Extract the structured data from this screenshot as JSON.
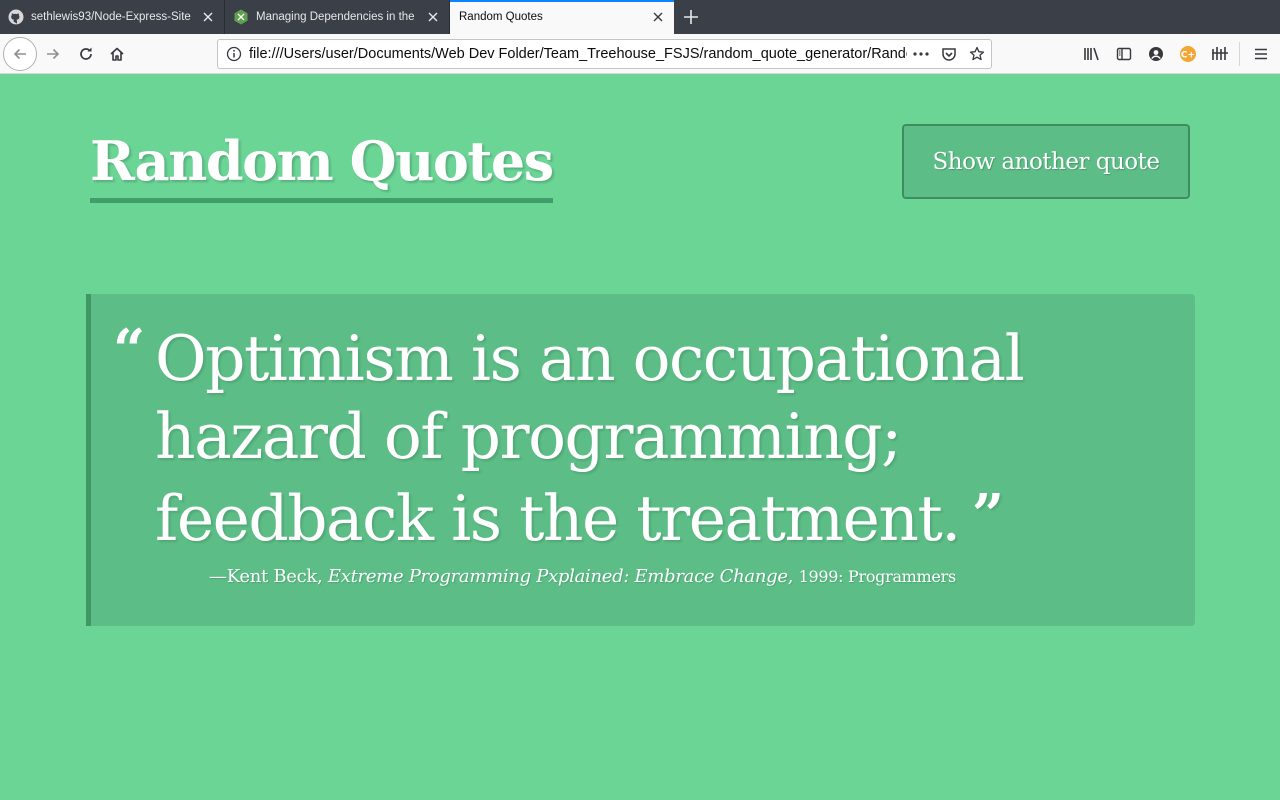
{
  "browser": {
    "tabs": [
      {
        "title": "sethlewis93/Node-Express-Site",
        "icon": "github-icon",
        "active": false
      },
      {
        "title": "Managing Dependencies in the",
        "icon": "node-icon",
        "active": false
      },
      {
        "title": "Random Quotes",
        "icon": "",
        "active": true
      }
    ],
    "url": "file:///Users/user/Documents/Web Dev Folder/Team_Treehouse_FSJS/random_quote_generator/Random"
  },
  "page": {
    "title": "Random Quotes",
    "button_label": "Show another quote",
    "quote": {
      "open_mark": "“",
      "text": "Optimism is an occupational hazard of programming; feedback is the treatment.",
      "close_mark": "”",
      "author": "—Kent Beck",
      "source": "Extreme Programming Pxplained: Embrace Change",
      "year": "1999",
      "tag": "Programmers"
    }
  },
  "colors": {
    "page_background": "#6bd596",
    "panel": "#5cbe86",
    "accent": "#3d9864",
    "tab_highlight": "#0a84ff"
  }
}
